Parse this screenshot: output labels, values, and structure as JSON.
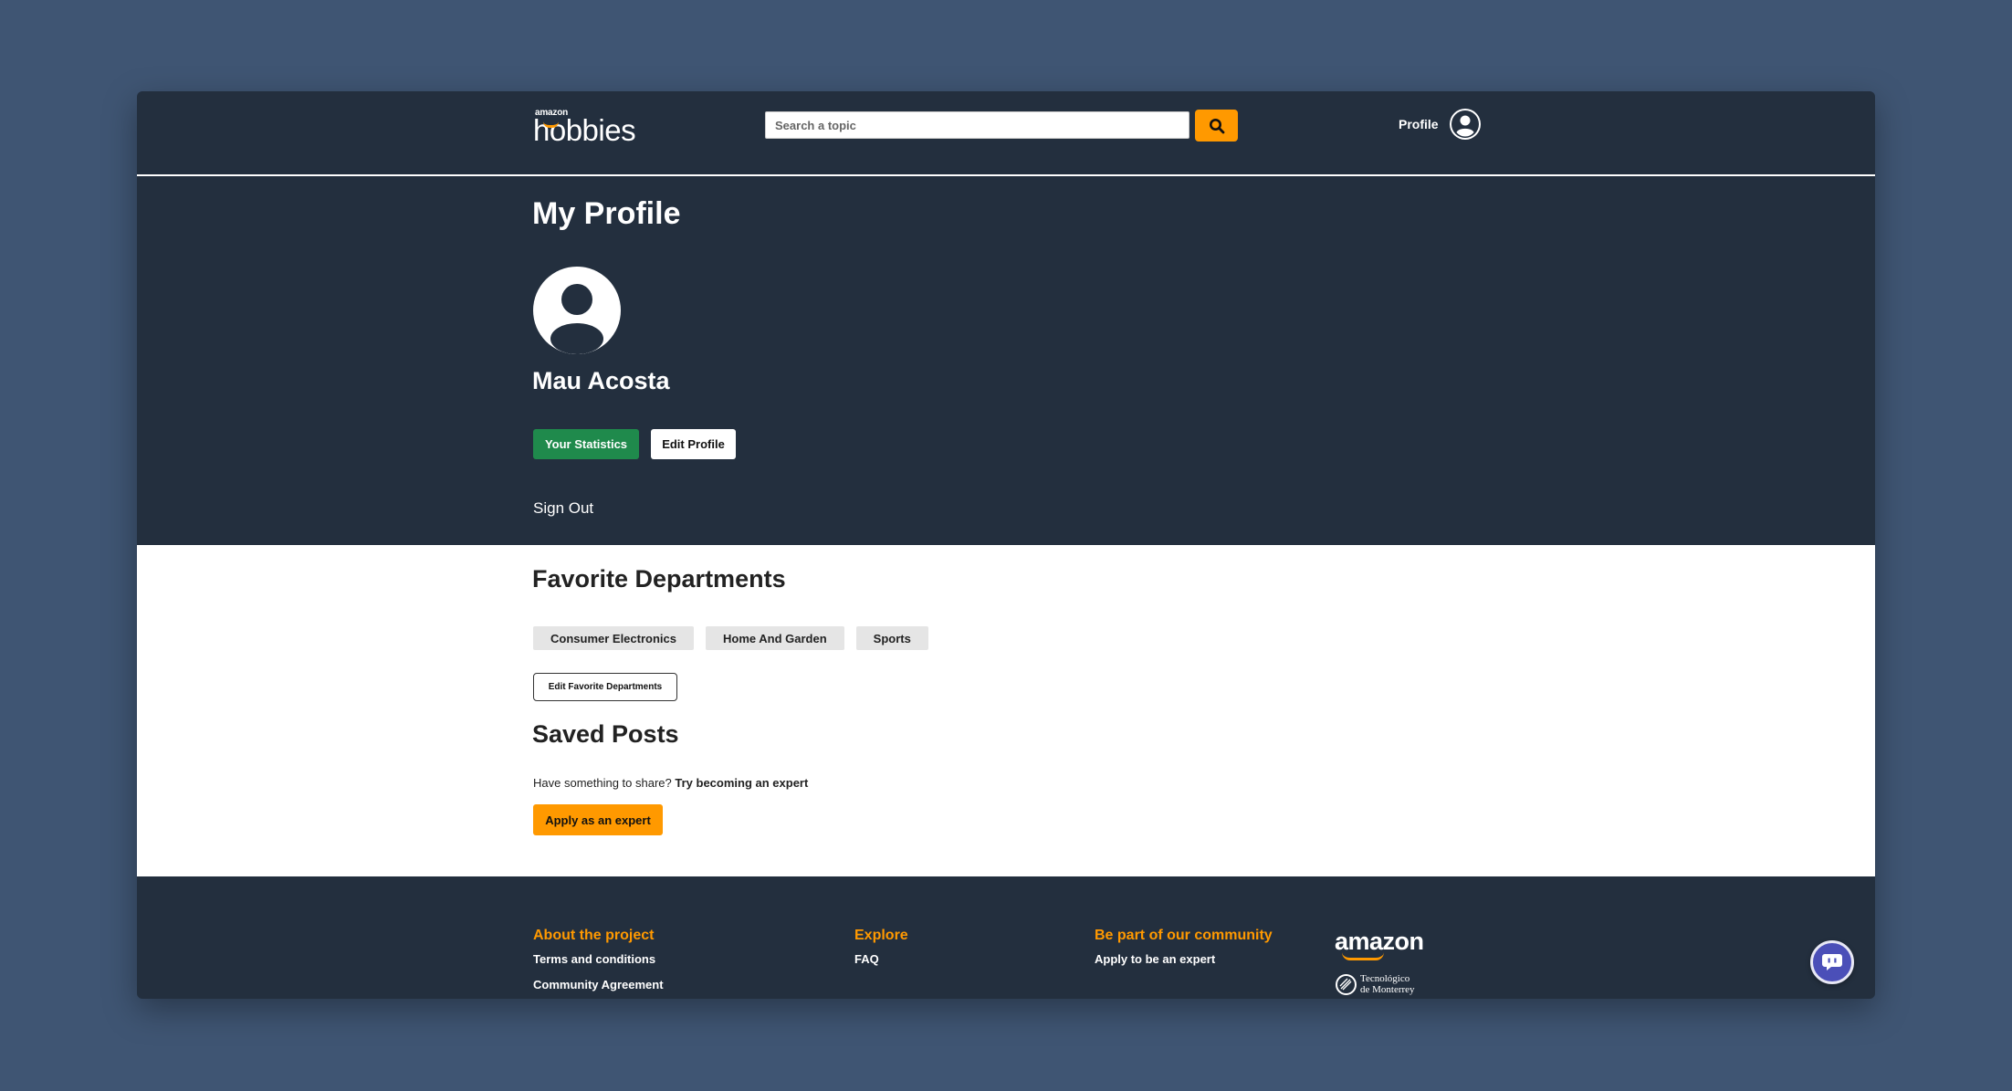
{
  "header": {
    "logo_small": "amazon",
    "logo_big": "hobbies",
    "search_placeholder": "Search a topic",
    "profile_label": "Profile"
  },
  "profile": {
    "title": "My Profile",
    "name": "Mau Acosta",
    "stats_label": "Your Statistics",
    "edit_label": "Edit Profile",
    "sign_out": "Sign Out"
  },
  "favorites": {
    "title": "Favorite Departments",
    "departments": [
      "Consumer Electronics",
      "Home And Garden",
      "Sports"
    ],
    "edit_label": "Edit Favorite Departments"
  },
  "saved": {
    "title": "Saved Posts",
    "prompt": "Have something to share?",
    "cta": "Try becoming an expert",
    "apply_label": "Apply as an expert"
  },
  "footer": {
    "about": {
      "heading": "About the project",
      "links": [
        "Terms and conditions",
        "Community Agreement"
      ]
    },
    "explore": {
      "heading": "Explore",
      "links": [
        "FAQ"
      ]
    },
    "community": {
      "heading": "Be part of our community",
      "links": [
        "Apply to be an expert"
      ]
    },
    "amazon_logo": "amazon",
    "tec_line1": "Tecnológico",
    "tec_line2": "de Monterrey"
  },
  "icons": {
    "search": "search-icon",
    "profile": "user-circle-icon",
    "chat": "chat-bubble-icon"
  },
  "colors": {
    "background": "#3f5573",
    "navy": "#232f3e",
    "accent_orange": "#ff9900",
    "stats_green": "#1f8a4c",
    "chat_purple": "#4b4fb8"
  }
}
